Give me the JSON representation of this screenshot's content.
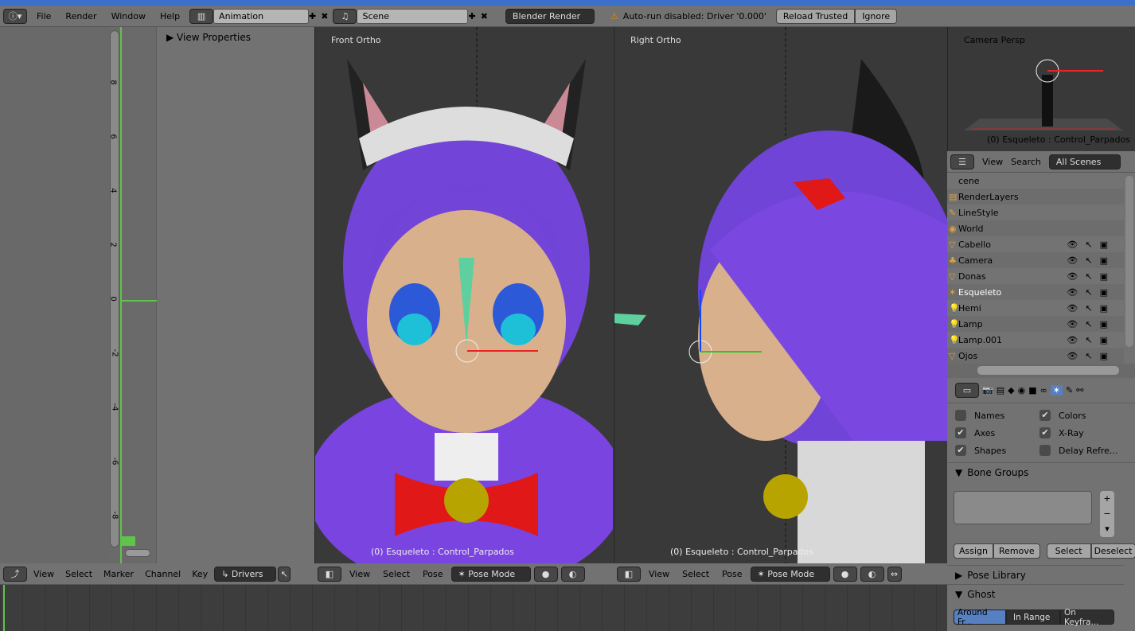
{
  "topbar": {
    "menus": [
      "File",
      "Render",
      "Window",
      "Help"
    ],
    "layout": "Animation",
    "scene": "Scene",
    "engine": "Blender Render",
    "warning": "Auto-run disabled: Driver '0.000'",
    "reload_trusted": "Reload Trusted",
    "ignore": "Ignore"
  },
  "graph_editor": {
    "view_properties": "View Properties",
    "ticks": [
      "8",
      "6",
      "4",
      "2",
      "0",
      "-2",
      "-4",
      "-6",
      "-8"
    ],
    "header_menus": [
      "View",
      "Select",
      "Marker",
      "Channel",
      "Key"
    ],
    "mode": "Drivers"
  },
  "viewports": [
    {
      "label": "Front Ortho",
      "footer": "(0) Esqueleto : Control_Parpados",
      "menus": [
        "View",
        "Select",
        "Pose"
      ],
      "mode": "Pose Mode"
    },
    {
      "label": "Right Ortho",
      "footer": "(0) Esqueleto : Control_Parpados",
      "menus": [
        "View",
        "Select",
        "Pose"
      ],
      "mode": "Pose Mode"
    }
  ],
  "camera_view": {
    "label": "Camera Persp",
    "footer": "(0) Esqueleto : Control_Parpados"
  },
  "outliner": {
    "menus": [
      "View",
      "Search"
    ],
    "filter": "All Scenes",
    "items": [
      {
        "name": "cene",
        "icon": "scene-icon"
      },
      {
        "name": "RenderLayers",
        "icon": "render-layers-icon"
      },
      {
        "name": "LineStyle",
        "icon": "linestyle-icon"
      },
      {
        "name": "World",
        "icon": "world-icon"
      },
      {
        "name": "Cabello",
        "icon": "mesh-icon",
        "vis": true
      },
      {
        "name": "Camera",
        "icon": "camera-icon",
        "vis": true
      },
      {
        "name": "Donas",
        "icon": "mesh-icon",
        "vis": true
      },
      {
        "name": "Esqueleto",
        "icon": "armature-icon",
        "vis": true
      },
      {
        "name": "Hemi",
        "icon": "lamp-icon",
        "vis": true
      },
      {
        "name": "Lamp",
        "icon": "lamp-icon",
        "vis": true
      },
      {
        "name": "Lamp.001",
        "icon": "lamp-icon",
        "vis": true
      },
      {
        "name": "Ojos",
        "icon": "mesh-icon",
        "vis": true
      }
    ]
  },
  "properties": {
    "display": [
      {
        "label": "Names",
        "checked": false
      },
      {
        "label": "Colors",
        "checked": true
      },
      {
        "label": "Axes",
        "checked": true
      },
      {
        "label": "X-Ray",
        "checked": true
      },
      {
        "label": "Shapes",
        "checked": true
      },
      {
        "label": "Delay Refre...",
        "checked": false
      }
    ],
    "bone_groups": "Bone Groups",
    "assign": "Assign",
    "remove": "Remove",
    "select": "Select",
    "deselect": "Deselect",
    "pose_library": "Pose Library",
    "ghost": "Ghost",
    "ghost_options": [
      "Around Fr...",
      "In Range",
      "On Keyfra..."
    ]
  },
  "colors": {
    "accent": "#5680c2",
    "graph_line": "#5ec44a",
    "hair": "#7a44e0"
  }
}
